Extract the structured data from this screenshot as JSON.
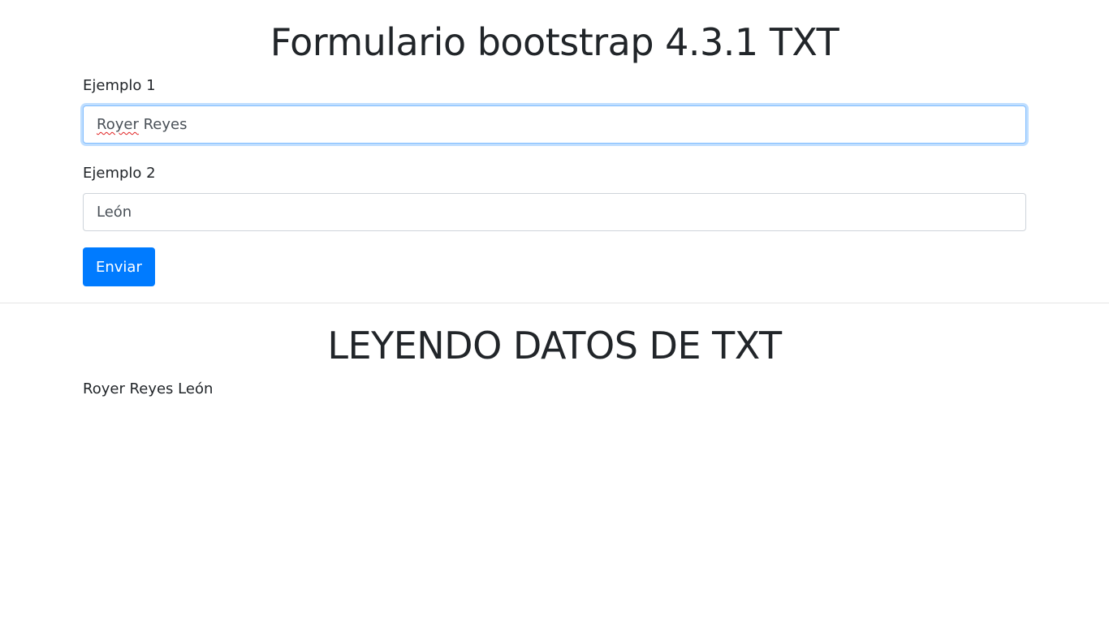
{
  "form": {
    "title": "Formulario bootstrap 4.3.1 TXT",
    "field1": {
      "label": "Ejemplo 1",
      "value_word1": "Royer",
      "value_rest": " Reyes"
    },
    "field2": {
      "label": "Ejemplo 2",
      "value": "León"
    },
    "submit_label": "Enviar"
  },
  "results": {
    "title": "LEYENDO DATOS DE TXT",
    "text": "Royer Reyes León"
  },
  "colors": {
    "primary": "#007bff",
    "focus_border": "#80bdff",
    "text": "#212529"
  }
}
